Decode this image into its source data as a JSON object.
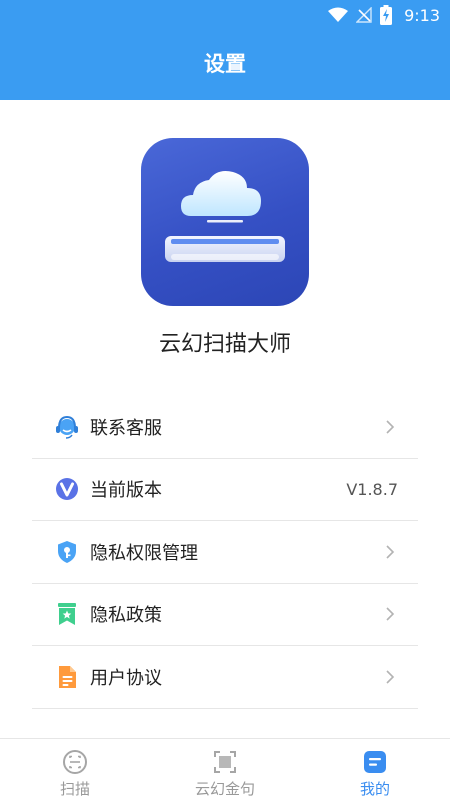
{
  "status_bar": {
    "time": "9:13"
  },
  "header": {
    "title": "设置"
  },
  "app": {
    "name": "云幻扫描大师"
  },
  "menu": {
    "items": [
      {
        "label": "联系客服",
        "icon": "customer-service-icon"
      },
      {
        "label": "当前版本",
        "icon": "version-icon",
        "value": "V1.8.7"
      },
      {
        "label": "隐私权限管理",
        "icon": "privacy-shield-icon"
      },
      {
        "label": "隐私政策",
        "icon": "policy-bookmark-icon"
      },
      {
        "label": "用户协议",
        "icon": "agreement-document-icon"
      }
    ]
  },
  "tabs": [
    {
      "label": "扫描",
      "icon": "scan-face-icon"
    },
    {
      "label": "云幻金句",
      "icon": "scan-frame-icon"
    },
    {
      "label": "我的",
      "icon": "profile-card-icon",
      "active": true
    }
  ],
  "colors": {
    "header": "#3a9cf2",
    "tab_active": "#3a8df0",
    "tab_inactive": "#999999",
    "logo": "#3550c4"
  }
}
